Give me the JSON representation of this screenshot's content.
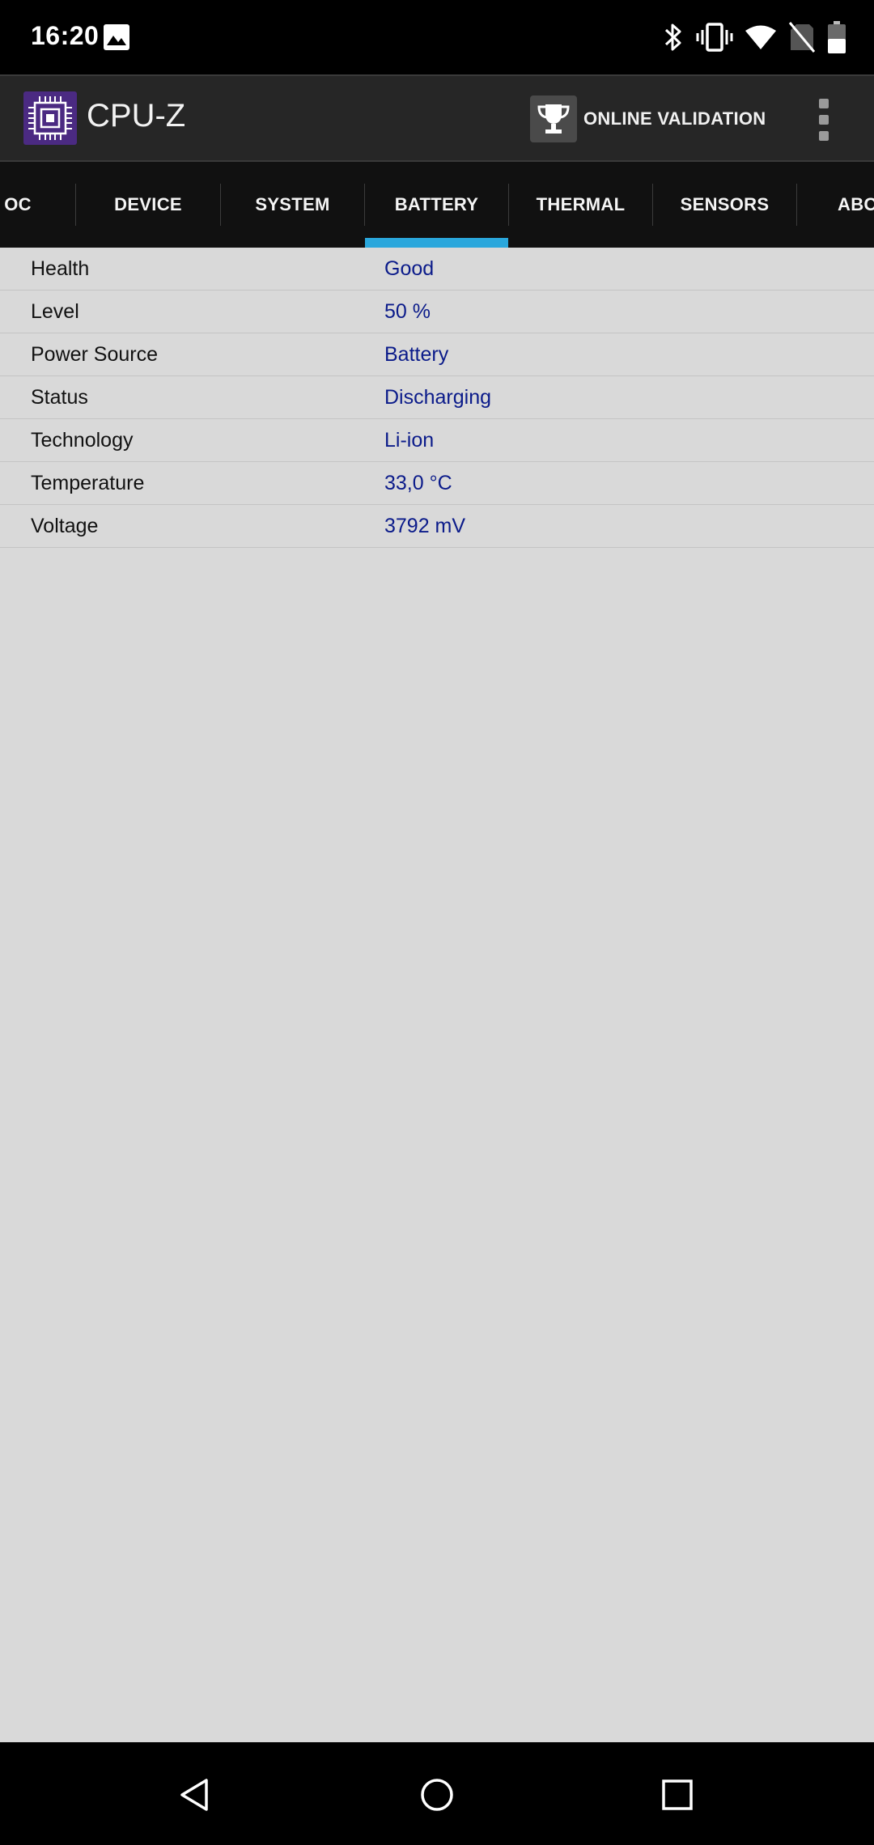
{
  "status_bar": {
    "time": "16:20",
    "icons": [
      "image-icon",
      "bluetooth-icon",
      "vibrate-icon",
      "wifi-icon",
      "no-sim-icon",
      "battery-icon"
    ]
  },
  "app_bar": {
    "title": "CPU-Z",
    "validation_label": "ONLINE VALIDATION",
    "logo_color": "#4b2a82"
  },
  "tabs": [
    {
      "label": "OC",
      "active": false
    },
    {
      "label": "DEVICE",
      "active": false
    },
    {
      "label": "SYSTEM",
      "active": false
    },
    {
      "label": "BATTERY",
      "active": true
    },
    {
      "label": "THERMAL",
      "active": false
    },
    {
      "label": "SENSORS",
      "active": false
    },
    {
      "label": "ABO",
      "active": false
    }
  ],
  "accent_color": "#2aa7dc",
  "value_color": "#0b1b8a",
  "battery_info": [
    {
      "label": "Health",
      "value": "Good"
    },
    {
      "label": "Level",
      "value": "50 %"
    },
    {
      "label": "Power Source",
      "value": "Battery"
    },
    {
      "label": "Status",
      "value": "Discharging"
    },
    {
      "label": "Technology",
      "value": "Li-ion"
    },
    {
      "label": "Temperature",
      "value": "33,0 °C"
    },
    {
      "label": "Voltage",
      "value": "3792 mV"
    }
  ],
  "nav_bar": {
    "buttons": [
      "back-icon",
      "home-icon",
      "recents-icon"
    ]
  }
}
